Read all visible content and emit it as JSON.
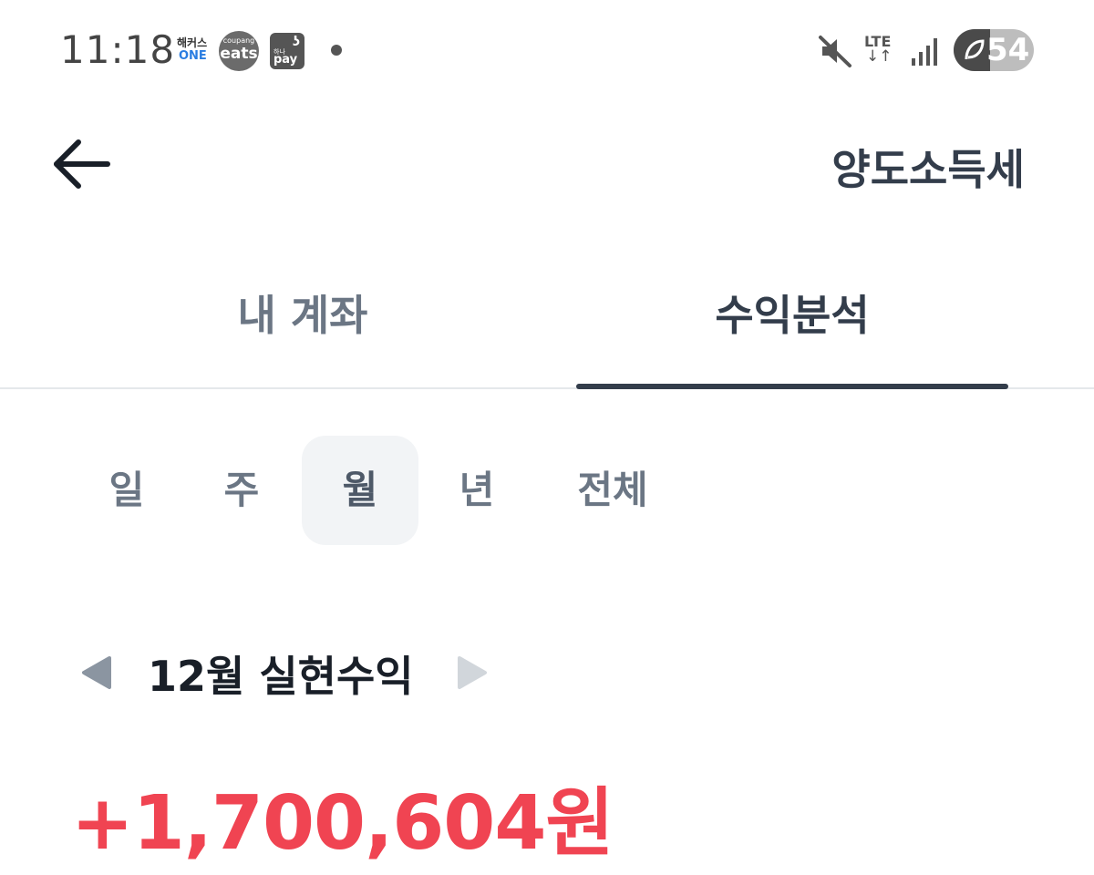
{
  "status_bar": {
    "time": "11:18",
    "apps": {
      "hackers_line1": "해커스",
      "hackers_line2": "ONE",
      "coupang_line1": "coupang",
      "coupang_line2": "eats",
      "hana_line1": "하나",
      "hana_line2": "pay",
      "hana_mark": "ʖ"
    },
    "network": "LTE",
    "network_arrows": "↓↑",
    "battery": "54",
    "colors": {
      "icons": "#555555",
      "battery_bg": "#bdbdbd",
      "battery_fill": "#4a4a4a"
    }
  },
  "header": {
    "back_icon": "arrow-left-icon",
    "title": "양도소득세"
  },
  "tabs": [
    {
      "label": "내 계좌",
      "selected": false
    },
    {
      "label": "수익분석",
      "selected": true
    }
  ],
  "periods": [
    {
      "label": "일",
      "selected": false
    },
    {
      "label": "주",
      "selected": false
    },
    {
      "label": "월",
      "selected": true
    },
    {
      "label": "년",
      "selected": false
    },
    {
      "label": "전체",
      "selected": false
    }
  ],
  "summary": {
    "prev_icon": "triangle-left-icon",
    "next_icon": "triangle-right-icon",
    "title": "12월 실현수익",
    "amount": "+1,700,604원"
  },
  "colors": {
    "primary_text": "#191f28",
    "tab_active": "#333d4b",
    "tab_inactive": "#6b7684",
    "profit_red": "#f04452",
    "pill_bg": "#f2f4f6"
  }
}
